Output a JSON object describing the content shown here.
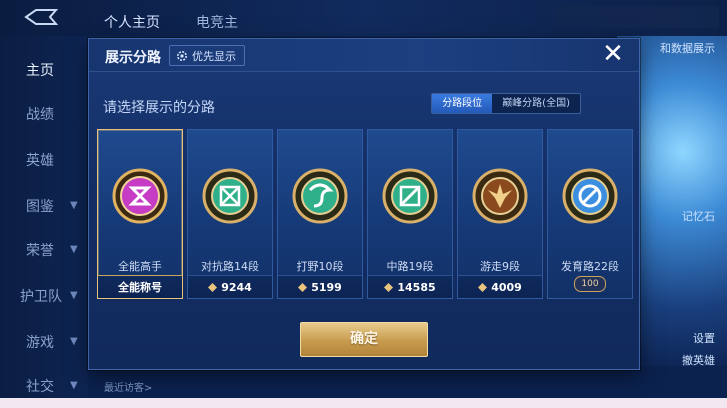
{
  "background": {
    "tabs": [
      "个人主页",
      "电竞主"
    ],
    "nav": [
      {
        "label": "主页",
        "active": true
      },
      {
        "label": "战绩"
      },
      {
        "label": "英雄"
      },
      {
        "label": "图鉴"
      },
      {
        "label": "荣誉"
      },
      {
        "label": "护卫队"
      },
      {
        "label": "游戏"
      },
      {
        "label": "社交"
      }
    ],
    "right_labels": [
      "和数据展示",
      "记忆石",
      "设置",
      "撤英雄"
    ],
    "bottom_text": "最近访客>"
  },
  "modal": {
    "title": "展示分路",
    "priority_chip": "优先显示",
    "close_icon": "close-icon",
    "subtitle": "请选择展示的分路",
    "segments": [
      {
        "label": "分路段位",
        "active": true
      },
      {
        "label": "巅峰分路(全国)",
        "active": false
      }
    ],
    "cards": [
      {
        "label": "全能高手",
        "footer": "全能称号",
        "selected": true,
        "medal_color": "#c63cc4",
        "icon": "all-round-medal-icon"
      },
      {
        "label": "对抗路14段",
        "footer": "9244",
        "medal_color": "#2fb08a",
        "icon": "clash-lane-medal-icon"
      },
      {
        "label": "打野10段",
        "footer": "5199",
        "medal_color": "#2fb08a",
        "icon": "jungle-medal-icon"
      },
      {
        "label": "中路19段",
        "footer": "14585",
        "medal_color": "#2fb08a",
        "icon": "mid-lane-medal-icon"
      },
      {
        "label": "游走9段",
        "footer": "4009",
        "medal_color": "#c98a3a",
        "icon": "roam-medal-icon"
      },
      {
        "label": "发育路22段",
        "footer": "",
        "badge": "100",
        "medal_color": "#3c8fe0",
        "icon": "farm-lane-medal-icon"
      }
    ],
    "confirm_label": "确定"
  }
}
